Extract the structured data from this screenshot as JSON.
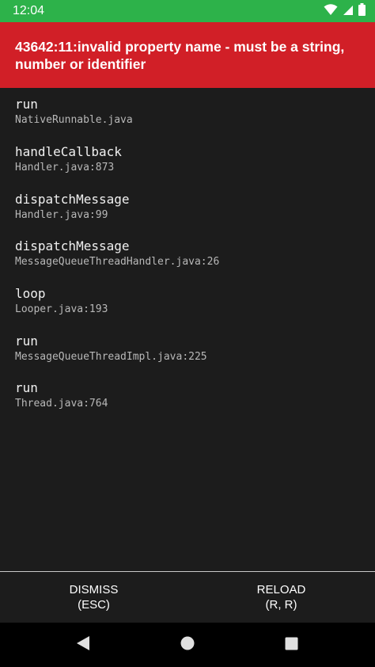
{
  "status_bar": {
    "time": "12:04",
    "icons": [
      "wifi-icon",
      "cell-signal-icon",
      "battery-icon"
    ]
  },
  "error": {
    "message": "43642:11:invalid property name - must be a string, number or identifier"
  },
  "stack": [
    {
      "method": "run",
      "location": "NativeRunnable.java"
    },
    {
      "method": "handleCallback",
      "location": "Handler.java:873"
    },
    {
      "method": "dispatchMessage",
      "location": "Handler.java:99"
    },
    {
      "method": "dispatchMessage",
      "location": "MessageQueueThreadHandler.java:26"
    },
    {
      "method": "loop",
      "location": "Looper.java:193"
    },
    {
      "method": "run",
      "location": "MessageQueueThreadImpl.java:225"
    },
    {
      "method": "run",
      "location": "Thread.java:764"
    }
  ],
  "buttons": {
    "dismiss": {
      "label": "DISMISS",
      "shortcut": "(ESC)"
    },
    "reload": {
      "label": "RELOAD",
      "shortcut": "(R, R)"
    }
  },
  "nav": {
    "icons": [
      "back-icon",
      "home-icon",
      "recents-icon"
    ]
  },
  "colors": {
    "status_bar": "#2db24a",
    "error_header": "#d11f27",
    "background": "#1c1c1c",
    "nav_bar": "#000000"
  }
}
